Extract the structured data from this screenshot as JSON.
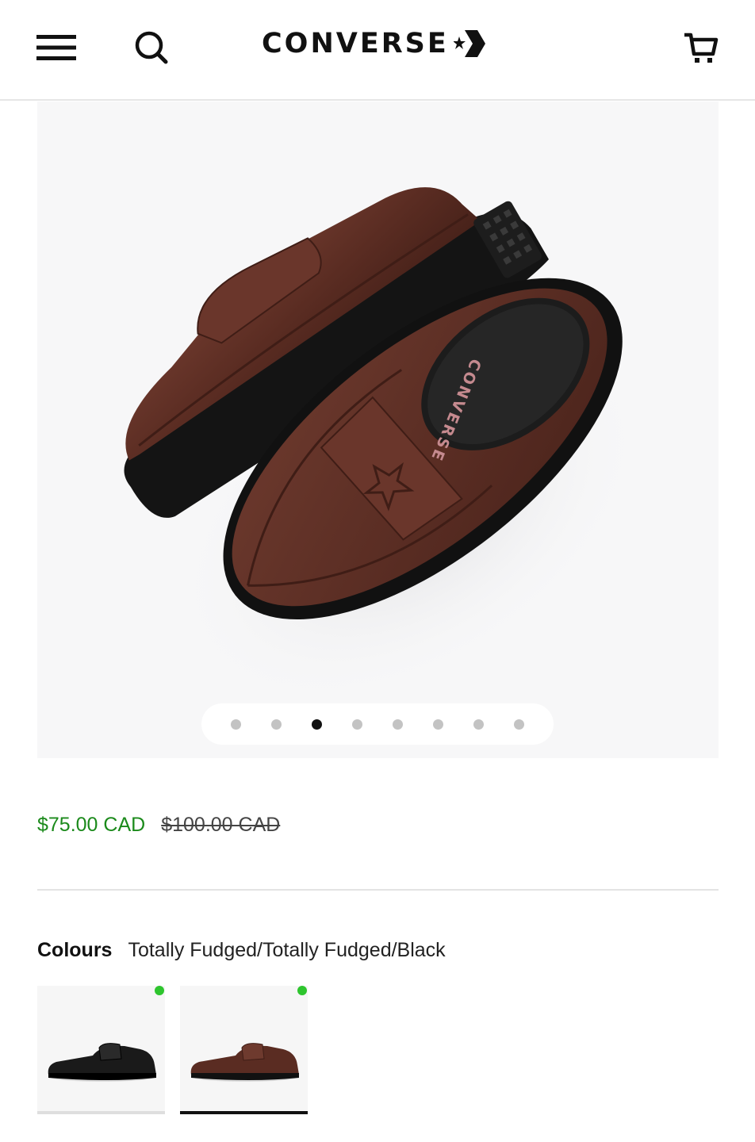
{
  "header": {
    "brand": "CONVERSE",
    "menu_icon": "hamburger-menu-icon",
    "search_icon": "search-icon",
    "cart_icon": "cart-icon",
    "logo_mark_icon": "star-chevron-logo-icon"
  },
  "gallery": {
    "image_icon": "brown-loafer-pair-image",
    "insole_text": "CONVERSE",
    "slide_count": 8,
    "active_slide": 3
  },
  "pricing": {
    "sale_price": "$75.00 CAD",
    "original_price": "$100.00 CAD"
  },
  "colours": {
    "label": "Colours",
    "selected_name": "Totally Fudged/Totally Fudged/Black",
    "swatches": [
      {
        "name": "black",
        "available": true,
        "selected": false
      },
      {
        "name": "brown",
        "available": true,
        "selected": true
      }
    ]
  },
  "colors": {
    "sale_green": "#1b8a1b",
    "availability_green": "#2ec52e",
    "leather_brown": "#5a2c22"
  }
}
